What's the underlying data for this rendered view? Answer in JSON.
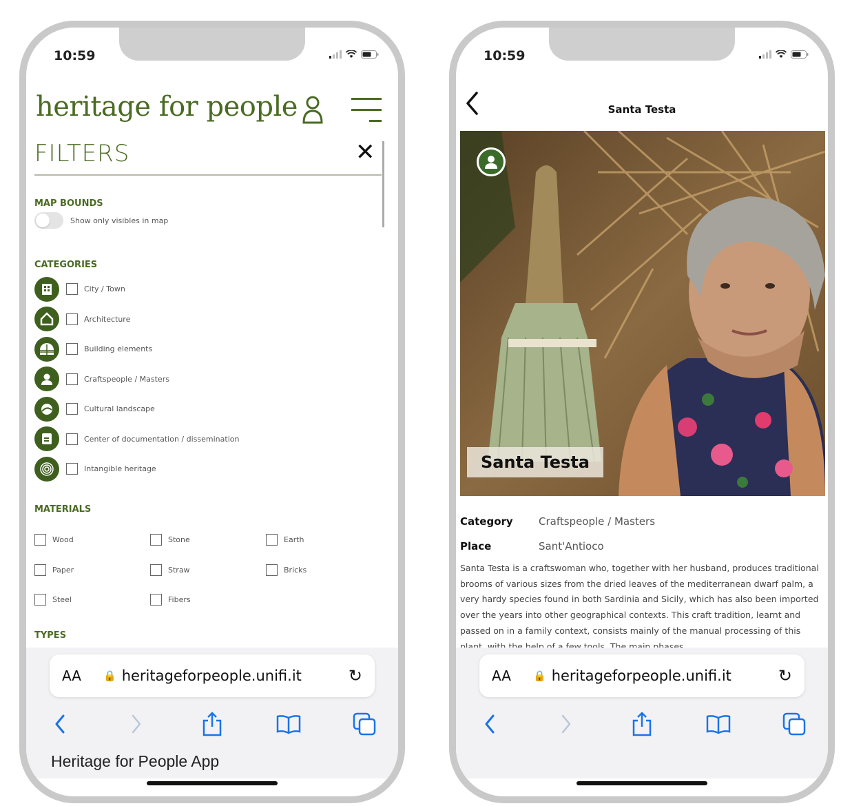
{
  "status": {
    "time": "10:59"
  },
  "left": {
    "brand": "heritage for people",
    "filters_title": "FILTERS",
    "close_glyph": "✕",
    "map_bounds": {
      "heading": "MAP BOUNDS",
      "toggle_label": "Show only visibles in map"
    },
    "categories": {
      "heading": "CATEGORIES",
      "items": [
        {
          "label": "City / Town",
          "icon": "city-icon"
        },
        {
          "label": "Architecture",
          "icon": "house-icon"
        },
        {
          "label": "Building elements",
          "icon": "building-elements-icon"
        },
        {
          "label": "Craftspeople / Masters",
          "icon": "person-icon"
        },
        {
          "label": "Cultural landscape",
          "icon": "landscape-icon"
        },
        {
          "label": "Center of documentation / dissemination",
          "icon": "document-icon"
        },
        {
          "label": "Intangible heritage",
          "icon": "fingerprint-icon"
        }
      ]
    },
    "materials": {
      "heading": "MATERIALS",
      "rows": [
        [
          "Wood",
          "Stone",
          "Earth"
        ],
        [
          "Paper",
          "Straw",
          "Bricks"
        ],
        [
          "Steel",
          "Fibers"
        ]
      ]
    },
    "types_heading": "TYPES",
    "caption": "Heritage for People App"
  },
  "right": {
    "nav_title": "Santa Testa",
    "photo_label": "Santa Testa",
    "category_key": "Category",
    "category_value": "Craftspeople / Masters",
    "place_key": "Place",
    "place_value": "Sant'Antioco",
    "description": "Santa Testa is a craftswoman who, together with her husband, produces traditional brooms of various sizes from the dried leaves of the mediterranean dwarf palm, a very hardy species found in both Sardinia and Sicily, which has also been imported over the years into other geographical contexts. This craft tradition, learnt and passed on in a family context, consists mainly of the manual processing of this plant, with the help of a few tools. The main phases"
  },
  "safari": {
    "aa": "AA",
    "url": "heritageforpeople.unifi.it"
  },
  "colors": {
    "brand_green": "#4a6b23",
    "icon_green": "#3f5f1f",
    "safari_blue": "#1a73e8"
  }
}
